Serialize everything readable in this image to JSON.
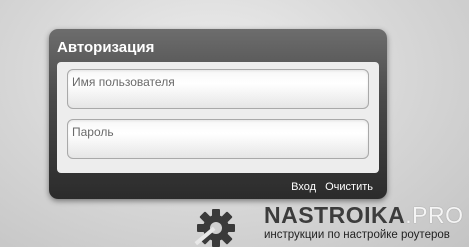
{
  "login": {
    "title": "Авторизация",
    "username_placeholder": "Имя пользователя",
    "password_placeholder": "Пароль",
    "login_label": "Вход",
    "clear_label": "Очистить"
  },
  "watermark": {
    "brand_main": "NASTROIKA",
    "brand_suffix": ".PRO",
    "tagline": "инструкции по настройке роутеров",
    "icon": "gear-wrench-icon"
  }
}
